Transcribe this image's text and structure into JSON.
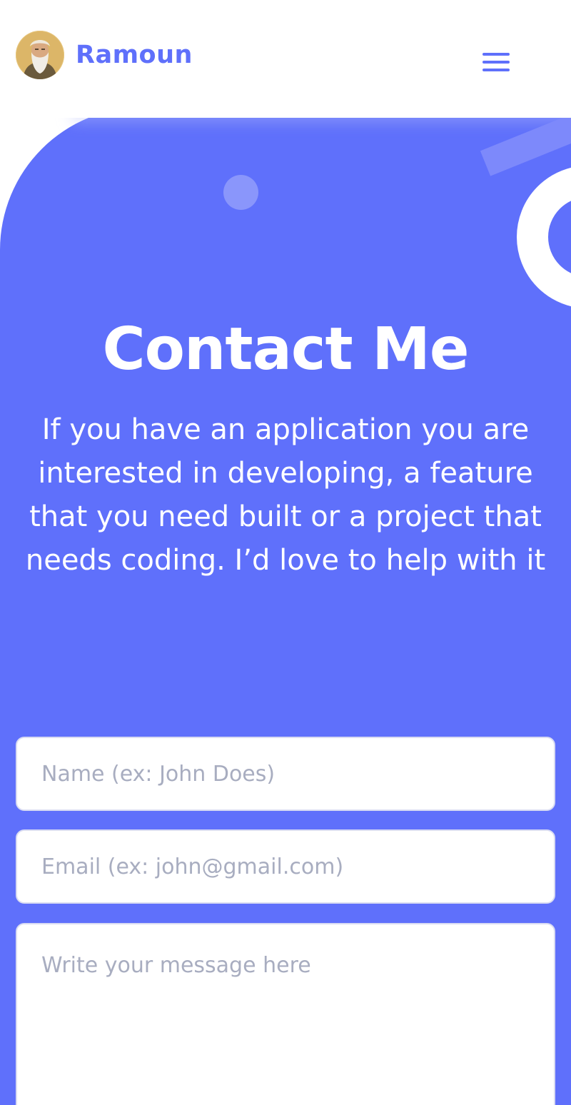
{
  "header": {
    "brand_name": "Ramoun",
    "menu_icon": "hamburger-menu-icon",
    "avatar": "portrait-avatar"
  },
  "hero": {
    "title": "Contact Me",
    "subtitle": "If you have an application you are interested in developing, a feature that you need built or a project that needs coding. I’d love to help with it"
  },
  "form": {
    "name_placeholder": "Name (ex: John Does)",
    "name_value": "",
    "email_placeholder": "Email (ex: john@gmail.com)",
    "email_value": "",
    "message_placeholder": "Write your message here",
    "message_value": ""
  },
  "colors": {
    "accent": "#5f70fb",
    "white": "#ffffff",
    "placeholder": "#a8adc0",
    "decor_light": "#8a96fb"
  }
}
